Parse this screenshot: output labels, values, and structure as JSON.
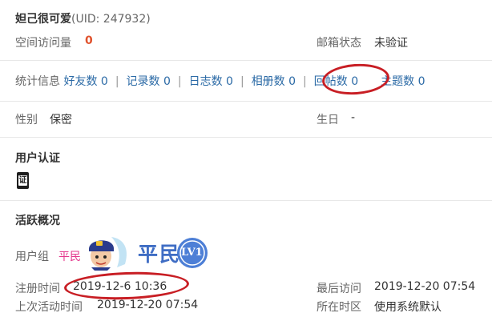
{
  "profile": {
    "username": "妲己很可爱",
    "uid_label": "(UID: 247932)",
    "space_visits_label": "空间访问量",
    "space_visits_value": "0",
    "email_status_label": "邮箱状态",
    "email_status_value": "未验证"
  },
  "stats": {
    "label": "统计信息",
    "items": [
      {
        "label": "好友数 0"
      },
      {
        "label": "记录数 0"
      },
      {
        "label": "日志数 0"
      },
      {
        "label": "相册数 0"
      },
      {
        "label": "回帖数 0"
      },
      {
        "label": "主题数 0"
      }
    ],
    "separator": "|"
  },
  "personal": {
    "gender_label": "性别",
    "gender_value": "保密",
    "birthday_label": "生日",
    "birthday_value": "-"
  },
  "verification": {
    "title": "用户认证",
    "badge_text": "证"
  },
  "activity": {
    "title": "活跃概况",
    "group_label": "用户组",
    "group_value": "平民",
    "rank_text": "平民",
    "rank_level": "LV1",
    "register_label": "注册时间",
    "register_value": "2019-12-6 10:36",
    "last_visit_label": "最后访问",
    "last_visit_value": "2019-12-20 07:54",
    "last_active_label": "上次活动时间",
    "last_active_value": "2019-12-20 07:54",
    "timezone_label": "所在时区",
    "timezone_value": "使用系统默认"
  },
  "colors": {
    "link": "#2b6aa6",
    "red_value": "#e0522d",
    "group_pink": "#e4398e",
    "annotation_circle": "#c81e24"
  }
}
